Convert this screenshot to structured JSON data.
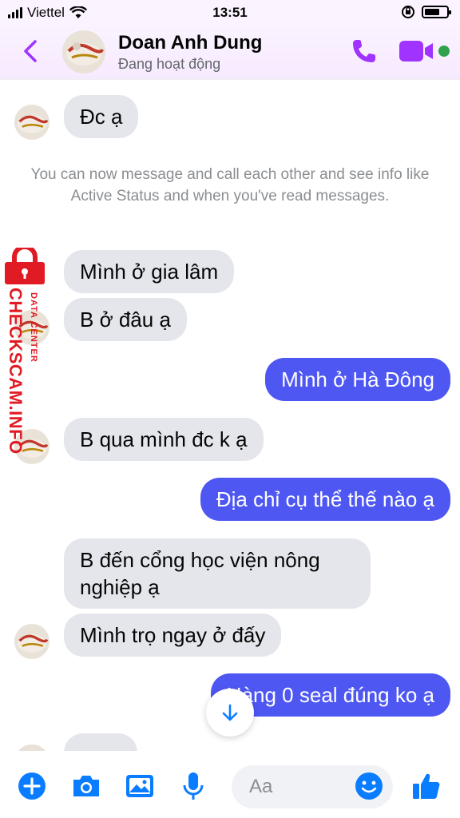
{
  "status_bar": {
    "carrier": "Viettel",
    "time": "13:51",
    "battery_level": 0.7
  },
  "header": {
    "contact_name": "Doan Anh Dung",
    "presence": "Đang hoạt động"
  },
  "messages": [
    {
      "from": "contact",
      "text": "Đc ạ"
    },
    {
      "from": "contact",
      "text": "Mình ở gia lâm"
    },
    {
      "from": "contact",
      "text": "B ở đâu ạ"
    },
    {
      "from": "me",
      "text": "Mình ở Hà Đông"
    },
    {
      "from": "contact",
      "text": "B qua mình đc k ạ"
    },
    {
      "from": "me",
      "text": "Địa chỉ cụ thể thế nào ạ"
    },
    {
      "from": "contact",
      "text": "B đến cổng học viện nông nghiệp ạ"
    },
    {
      "from": "contact",
      "text": "Mình trọ ngay ở đấy"
    },
    {
      "from": "me",
      "text": "Hàng 0 seal đúng ko ạ"
    }
  ],
  "system_note": "You can now message and call each other and see info like Active Status and when you've read messages.",
  "watermark": {
    "brand": "CHECKSCAM.INFO",
    "tagline": "DATA CENTER"
  },
  "composer": {
    "placeholder": "Aa"
  },
  "colors": {
    "accent": "#a033ff",
    "outgoing_bubble": "#4e57f2",
    "incoming_bubble": "#e4e6eb",
    "composer_icons": "#0a7cff",
    "online": "#31a24c"
  }
}
